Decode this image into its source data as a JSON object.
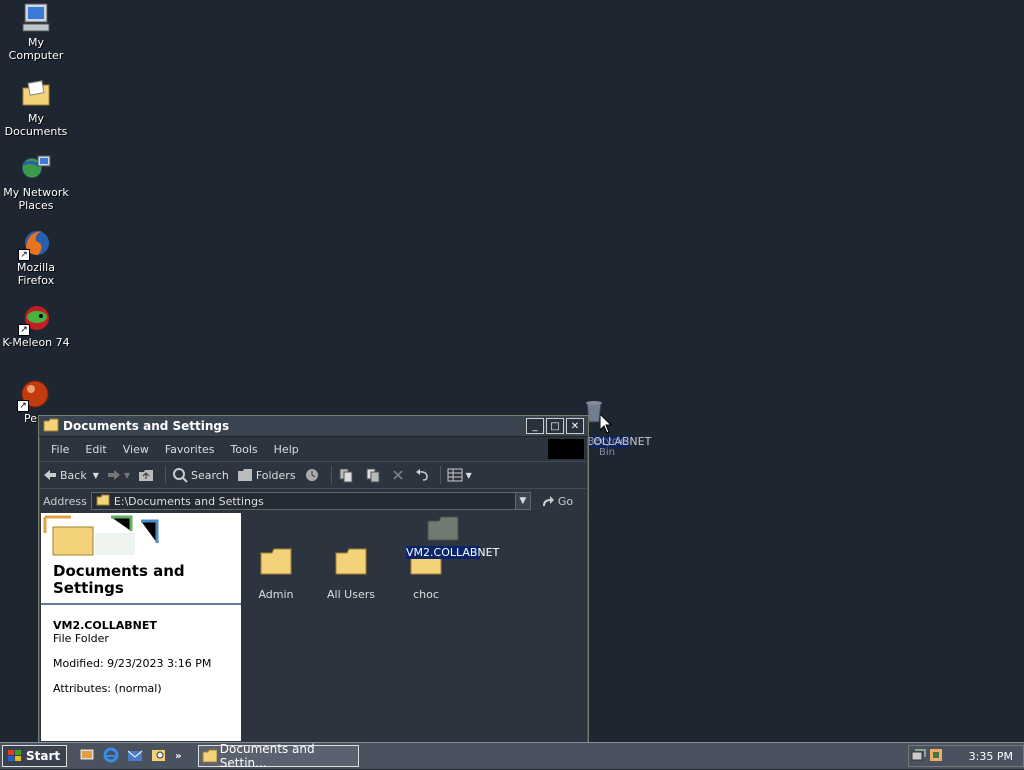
{
  "desktop": {
    "icons": [
      {
        "label": "My Computer"
      },
      {
        "label": "My Documents"
      },
      {
        "label": "My Network Places"
      },
      {
        "label": "Mozilla Firefox"
      },
      {
        "label": "K-Meleon 74"
      },
      {
        "label": "Pe"
      }
    ],
    "drag_ghost": {
      "label": "VM2.COLLABNET",
      "underlay": "Recycle Bin"
    }
  },
  "window": {
    "title": "Documents and Settings",
    "menu": [
      "File",
      "Edit",
      "View",
      "Favorites",
      "Tools",
      "Help"
    ],
    "toolbar": {
      "back": "Back",
      "search": "Search",
      "folders": "Folders"
    },
    "address": {
      "label": "Address",
      "value": "E:\\Documents and Settings",
      "go": "Go"
    },
    "task_pane": {
      "title": "Documents and Settings",
      "selected_name": "VM2.COLLABNET",
      "selected_type": "File Folder",
      "modified": "Modified: 9/23/2023 3:16 PM",
      "attributes": "Attributes: (normal)"
    },
    "files": [
      {
        "label": "Admin"
      },
      {
        "label": "All Users"
      },
      {
        "label": "choc"
      },
      {
        "label": "VM2.COLLABNET",
        "selected": true
      }
    ]
  },
  "taskbar": {
    "start": "Start",
    "task": "Documents and Settin...",
    "clock": "3:35 PM"
  }
}
